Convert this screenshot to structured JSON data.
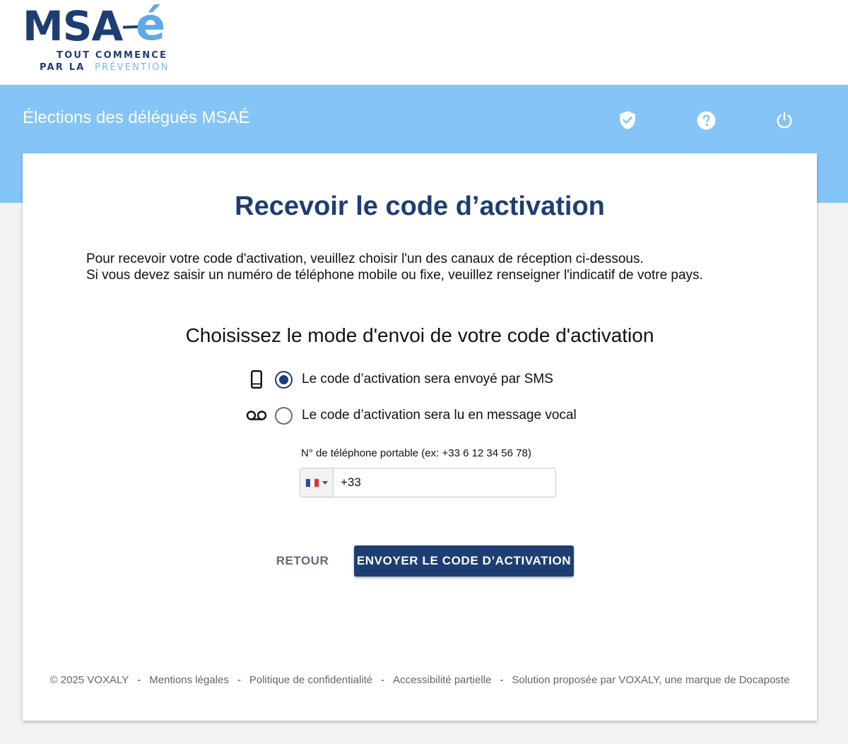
{
  "logo": {
    "main": "MSA",
    "accent": "é",
    "tagline_1": "TOUT COMMENCE",
    "tagline_2_a": "PAR LA",
    "tagline_2_b": "PRÉVENTION"
  },
  "header": {
    "title": "Élections des délégués MSAÉ",
    "icons": [
      "shield-check-icon",
      "help-icon",
      "power-icon"
    ]
  },
  "page": {
    "title": "Recevoir le code d’activation",
    "intro_line_1": "Pour recevoir votre code d'activation, veuillez choisir l'un des canaux de réception ci-dessous.",
    "intro_line_2": "Si vous devez saisir un numéro de téléphone mobile ou fixe, veuillez renseigner l'indicatif de votre pays.",
    "subtitle": "Choisissez le mode d'envoi de votre code d'activation"
  },
  "options": [
    {
      "label": "Le code d’activation sera envoyé par SMS",
      "icon": "smartphone-icon",
      "selected": true
    },
    {
      "label": "Le code d’activation sera lu en message vocal",
      "icon": "voicemail-icon",
      "selected": false
    }
  ],
  "phone": {
    "label": "N° de téléphone portable (ex: +33 6 12 34 56 78)",
    "value": "+33",
    "country_flag": "france-flag-icon"
  },
  "buttons": {
    "back": "RETOUR",
    "send": "ENVOYER LE CODE D’ACTIVATION"
  },
  "footer": {
    "copyright": "© 2025 VOXALY",
    "links": [
      "Mentions légales",
      "Politique de confidentialité",
      "Accessibilité partielle"
    ],
    "credit": "Solution proposée par VOXALY, une marque de Docaposte",
    "separator": "-"
  },
  "colors": {
    "band": "#84c4f6",
    "primary": "#1e3e73",
    "logo_accent": "#5ea9e6"
  }
}
